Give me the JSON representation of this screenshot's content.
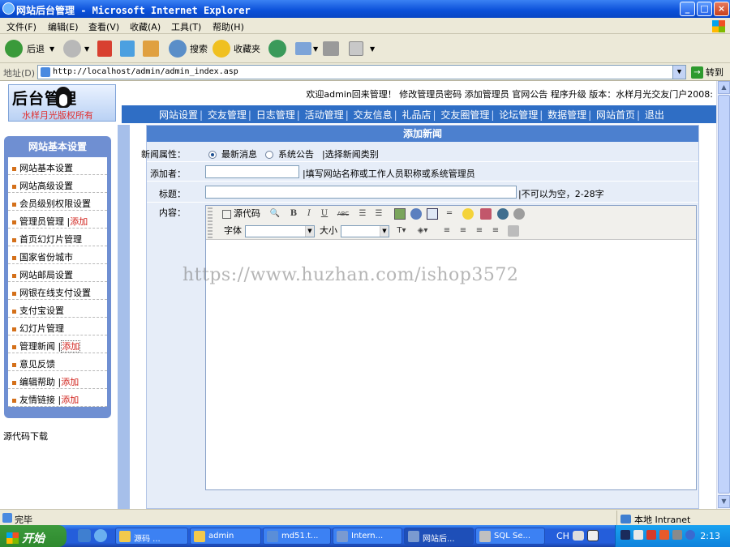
{
  "window": {
    "title": "网站后台管理 - Microsoft Internet Explorer",
    "minimize": "_",
    "maximize": "□",
    "close": "×"
  },
  "menu": [
    "文件(F)",
    "编辑(E)",
    "查看(V)",
    "收藏(A)",
    "工具(T)",
    "帮助(H)"
  ],
  "toolbar": {
    "back": "后退",
    "search": "搜索",
    "favorites": "收藏夹"
  },
  "address": {
    "label": "地址(D)",
    "url": "http://localhost/admin/admin_index.asp",
    "go": "转到",
    "go_arrow": "→",
    "dropdown": "▼"
  },
  "site": {
    "logo_title": "后台管理",
    "logo_subtitle": "水样月光版权所有",
    "welcome": "欢迎admin回来管理！ 修改管理员密码 添加管理员 官网公告 程序升级 版本：水样月光交友门户2008:",
    "nav": [
      "网站设置",
      "交友管理",
      "日志管理",
      "活动管理",
      "交友信息",
      "礼品店",
      "交友圈管理",
      "论坛管理",
      "数据管理",
      "网站首页",
      "退出"
    ],
    "nav_sep": "|"
  },
  "sidebar": {
    "title": "网站基本设置",
    "items": [
      {
        "label": "网站基本设置",
        "add": ""
      },
      {
        "label": "网站高级设置",
        "add": ""
      },
      {
        "label": "会员级别权限设置",
        "add": ""
      },
      {
        "label": "管理员管理 |",
        "add": "添加"
      },
      {
        "label": "首页幻灯片管理",
        "add": ""
      },
      {
        "label": "国家省份城市",
        "add": ""
      },
      {
        "label": "网站邮局设置",
        "add": ""
      },
      {
        "label": "网银在线支付设置",
        "add": ""
      },
      {
        "label": "支付宝设置",
        "add": ""
      },
      {
        "label": "幻灯片管理",
        "add": ""
      },
      {
        "label": "管理新闻 |",
        "add": "添加"
      },
      {
        "label": "意见反馈",
        "add": ""
      },
      {
        "label": "编辑帮助 |",
        "add": "添加"
      },
      {
        "label": "友情链接 |",
        "add": "添加"
      }
    ],
    "source_download": "源代码下载"
  },
  "form": {
    "heading": "添加新闻",
    "attr_label": "新闻属性：",
    "radio1": "最新消息",
    "radio2": "系统公告",
    "category_link": "|选择新闻类别",
    "adder_label": "添加者：",
    "adder_hint": "|填写网站名称或工作人员职称或系统管理员",
    "title_label": "标题：",
    "title_hint": "|不可以为空，2-28字",
    "content_label": "内容：",
    "editor": {
      "source": "源代码",
      "font_label": "字体",
      "size_label": "大小",
      "bold": "B",
      "italic": "I",
      "underline": "U",
      "strike": "ABC"
    }
  },
  "watermark": "https://www.huzhan.com/ishop3572",
  "status": {
    "text": "完毕",
    "zone": "本地 Intranet"
  },
  "taskbar": {
    "start": "开始",
    "tasks": [
      "源码 ...",
      "admin",
      "md51.t...",
      "Intern...",
      "网站后...",
      "SQL Se..."
    ],
    "lang": "CH",
    "clock": "2:13"
  }
}
